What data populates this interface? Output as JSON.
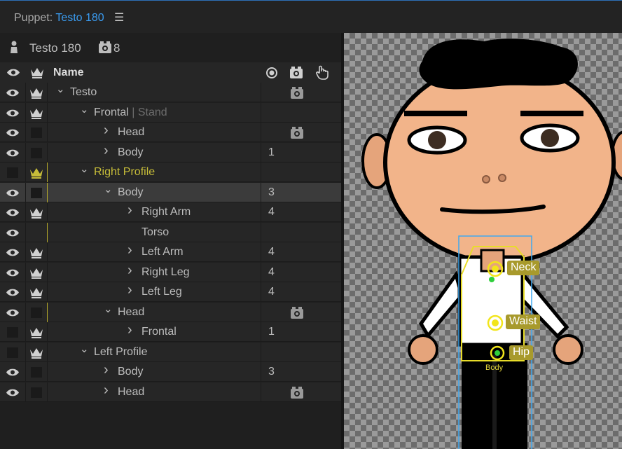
{
  "title": {
    "prefix": "Puppet:",
    "puppet_name": "Testo 180",
    "menu_icon": "hamburger-icon"
  },
  "puppet": {
    "name": "Testo 180",
    "camera_count": "8"
  },
  "header": {
    "name": "Name",
    "col_icons": [
      "record-icon",
      "camera-icon",
      "hand-icon"
    ]
  },
  "rows": [
    {
      "label": "Testo",
      "tag": "",
      "indent": 0,
      "expanded": true,
      "has_children": true,
      "eye": true,
      "crown": "white",
      "num": "",
      "camera": true
    },
    {
      "label": "Frontal",
      "tag": "| Stand",
      "indent": 1,
      "expanded": true,
      "has_children": true,
      "eye": true,
      "crown": "white",
      "num": "",
      "camera": false
    },
    {
      "label": "Head",
      "tag": "",
      "indent": 2,
      "expanded": false,
      "has_children": true,
      "eye": true,
      "crown": "none",
      "num": "",
      "camera": true
    },
    {
      "label": "Body",
      "tag": "",
      "indent": 2,
      "expanded": false,
      "has_children": true,
      "eye": true,
      "crown": "none",
      "num": "1",
      "camera": false
    },
    {
      "label": "Right Profile",
      "tag": "",
      "indent": 1,
      "expanded": true,
      "has_children": true,
      "eye": false,
      "crown": "yellow",
      "num": "",
      "camera": false
    },
    {
      "label": "Body",
      "tag": "",
      "indent": 2,
      "expanded": true,
      "has_children": true,
      "eye": true,
      "crown": "none",
      "num": "3",
      "camera": false,
      "selected": true
    },
    {
      "label": "Right Arm",
      "tag": "",
      "indent": 3,
      "expanded": false,
      "has_children": true,
      "eye": true,
      "crown": "white",
      "num": "4",
      "camera": false
    },
    {
      "label": "Torso",
      "tag": "",
      "indent": 3,
      "expanded": false,
      "has_children": false,
      "eye": true,
      "crown": "blank",
      "num": "",
      "camera": false
    },
    {
      "label": "Left Arm",
      "tag": "",
      "indent": 3,
      "expanded": false,
      "has_children": true,
      "eye": true,
      "crown": "white",
      "num": "4",
      "camera": false
    },
    {
      "label": "Right Leg",
      "tag": "",
      "indent": 3,
      "expanded": false,
      "has_children": true,
      "eye": true,
      "crown": "white",
      "num": "4",
      "camera": false
    },
    {
      "label": "Left Leg",
      "tag": "",
      "indent": 3,
      "expanded": false,
      "has_children": true,
      "eye": true,
      "crown": "white",
      "num": "4",
      "camera": false
    },
    {
      "label": "Head",
      "tag": "",
      "indent": 2,
      "expanded": true,
      "has_children": true,
      "eye": true,
      "crown": "none",
      "num": "",
      "camera": true
    },
    {
      "label": "Frontal",
      "tag": "",
      "indent": 3,
      "expanded": false,
      "has_children": true,
      "eye": false,
      "crown": "white",
      "num": "1",
      "camera": false
    },
    {
      "label": "Left Profile",
      "tag": "",
      "indent": 1,
      "expanded": true,
      "has_children": true,
      "eye": false,
      "crown": "white",
      "num": "",
      "camera": false
    },
    {
      "label": "Body",
      "tag": "",
      "indent": 2,
      "expanded": false,
      "has_children": true,
      "eye": true,
      "crown": "none",
      "num": "3",
      "camera": false
    },
    {
      "label": "Head",
      "tag": "",
      "indent": 2,
      "expanded": false,
      "has_children": true,
      "eye": true,
      "crown": "none",
      "num": "",
      "camera": true
    }
  ],
  "handles": {
    "neck": "Neck",
    "waist": "Waist",
    "hip": "Hip",
    "body": "Body"
  },
  "colors": {
    "accent_blue": "#3a9bf0",
    "yellow": "#c7bd39",
    "handle_bg": "#a89a2c"
  }
}
